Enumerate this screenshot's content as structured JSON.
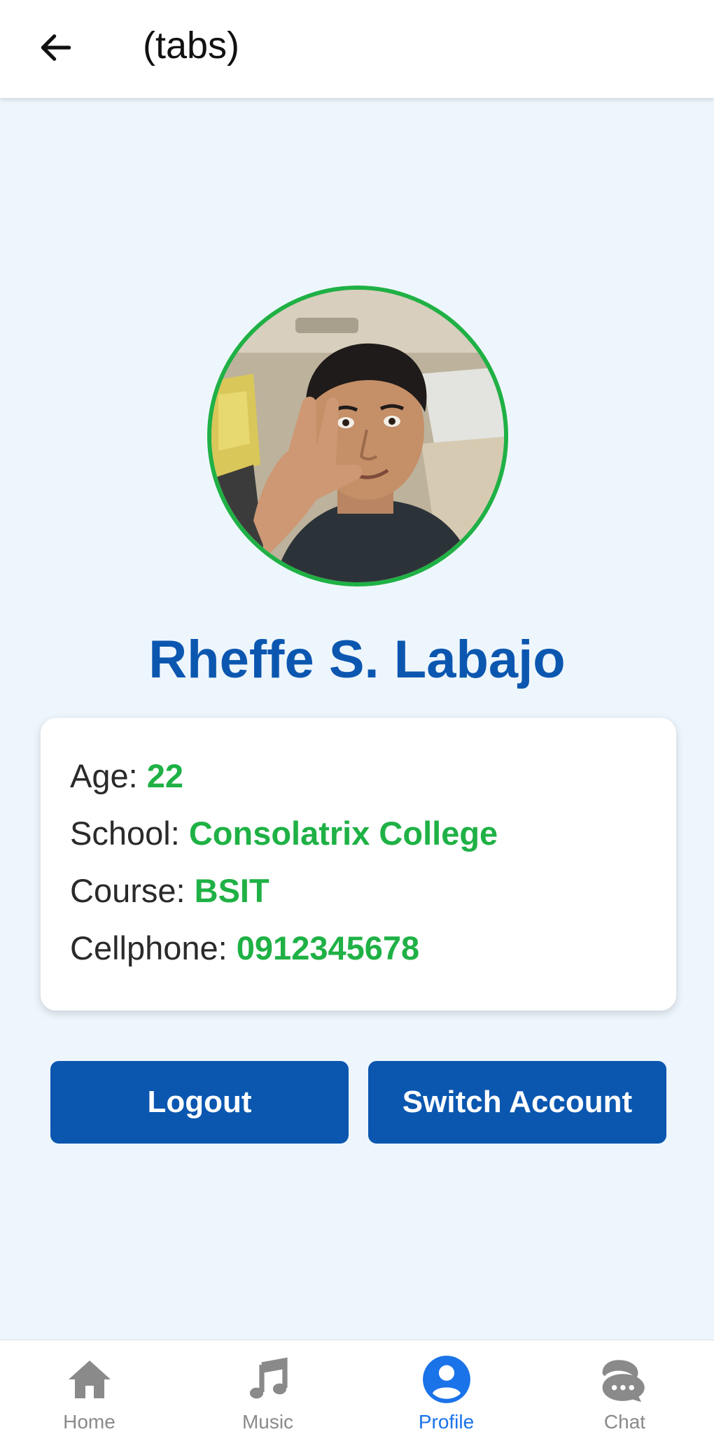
{
  "header": {
    "title": "(tabs)",
    "back_icon": "arrow-left-icon"
  },
  "profile": {
    "name": "Rheffe S. Labajo",
    "avatar_icon": "profile-photo",
    "details": [
      {
        "label": "Age: ",
        "value": "22"
      },
      {
        "label": "School: ",
        "value": "Consolatrix College"
      },
      {
        "label": "Course: ",
        "value": "BSIT"
      },
      {
        "label": "Cellphone: ",
        "value": "0912345678"
      }
    ]
  },
  "buttons": {
    "logout_label": "Logout",
    "switch_label": "Switch Account"
  },
  "tabs": [
    {
      "label": "Home",
      "icon": "home-icon",
      "active": false
    },
    {
      "label": "Music",
      "icon": "music-note-icon",
      "active": false
    },
    {
      "label": "Profile",
      "icon": "user-circle-icon",
      "active": true
    },
    {
      "label": "Chat",
      "icon": "chat-bubbles-icon",
      "active": false
    }
  ],
  "colors": {
    "accent": "#0b57b0",
    "value_green": "#1fb145",
    "tab_active": "#1a73e8",
    "tab_inactive": "#8a8a8a",
    "background": "#eef6fd"
  }
}
